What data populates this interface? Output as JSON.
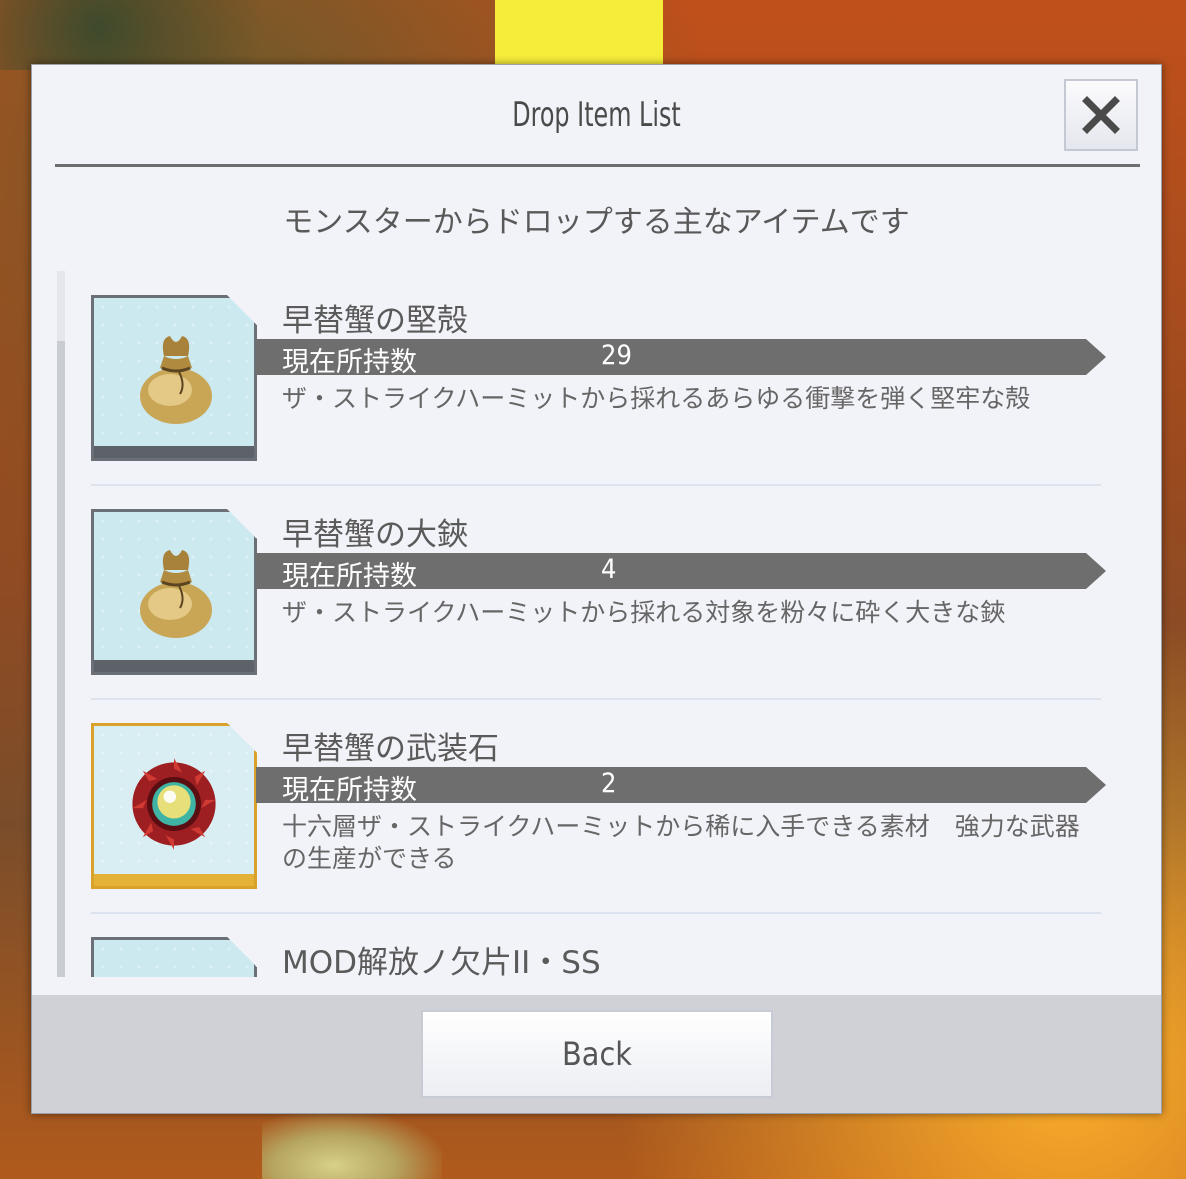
{
  "dialog": {
    "title": "Drop Item List",
    "subtitle": "モンスターからドロップする主なアイテムです",
    "back_label": "Back"
  },
  "items": [
    {
      "name": "早替蟹の堅殻",
      "count_label": "現在所持数",
      "count": "29",
      "description": "ザ・ストライクハーミットから採れるあらゆる衝撃を弾く堅牢な殻",
      "icon": "bag-icon"
    },
    {
      "name": "早替蟹の大鋏",
      "count_label": "現在所持数",
      "count": "4",
      "description": "ザ・ストライクハーミットから採れる対象を粉々に砕く大きな鋏",
      "icon": "bag-icon"
    },
    {
      "name": "早替蟹の武装石",
      "count_label": "現在所持数",
      "count": "2",
      "description": "十六層ザ・ストライクハーミットから稀に入手できる素材　強力な武器の生産ができる",
      "icon": "orb-icon"
    },
    {
      "name": "MOD解放ノ欠片II・SS",
      "icon": "item-icon"
    }
  ],
  "colors": {
    "bar": "#6e6e6e",
    "gold_frame": "#d9a22a",
    "dialog_bg": "#f2f3f8"
  }
}
